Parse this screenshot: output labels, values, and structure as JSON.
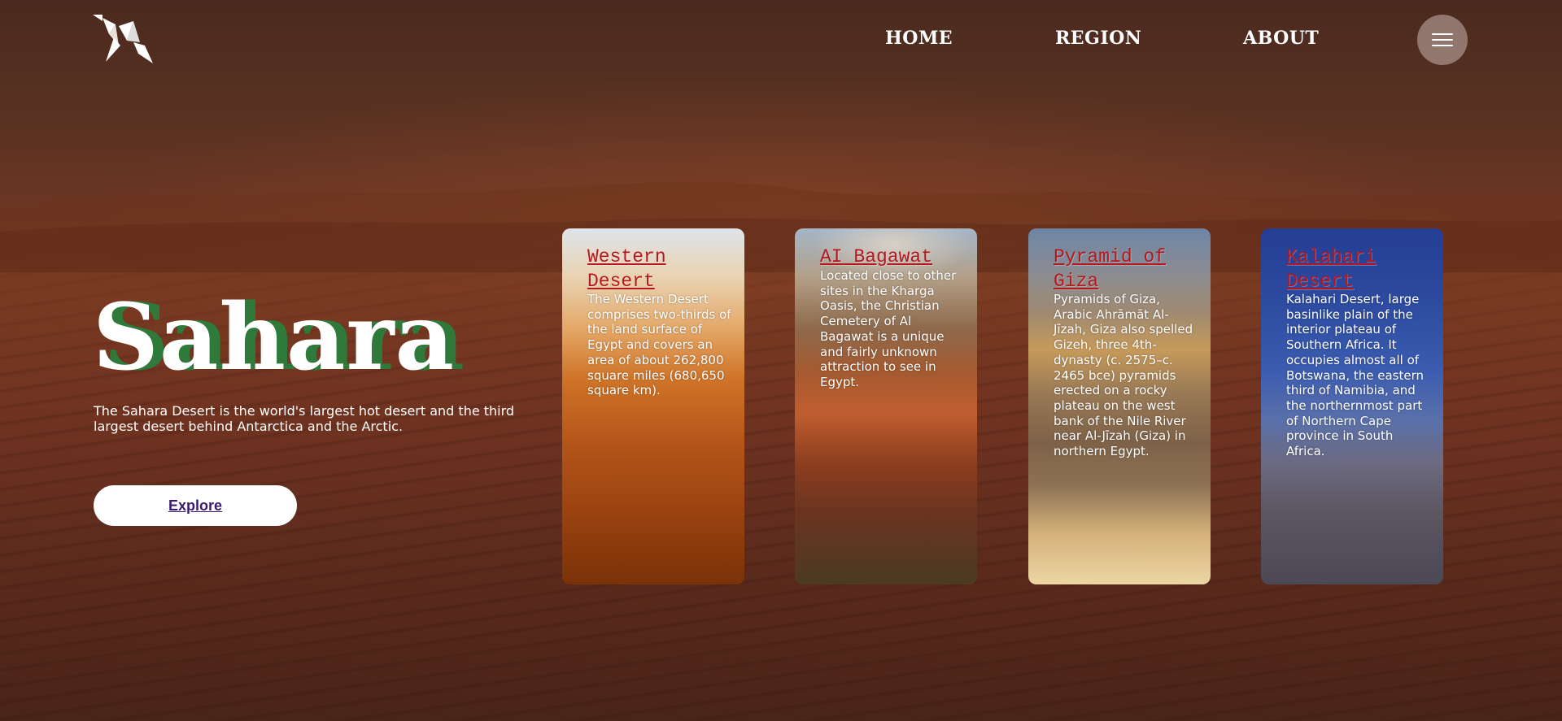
{
  "header": {
    "logo_icon": "origami-bird-logo",
    "nav": [
      {
        "label": "HOME"
      },
      {
        "label": "REGION"
      },
      {
        "label": "ABOUT"
      }
    ],
    "menu_icon": "hamburger-menu-icon"
  },
  "hero": {
    "title": "Sahara",
    "description": "The Sahara Desert is the world's largest hot desert and the third largest desert behind Antarctica and the Arctic.",
    "explore_label": "Explore",
    "title_shadow_color": "#2f7a3a"
  },
  "cards": [
    {
      "title": "Western Desert",
      "text": "The Western Desert comprises two-thirds of the land surface of Egypt and covers an area of about 262,800 square miles (680,650 square km)."
    },
    {
      "title": "AI Bagawat",
      "text": "Located close to other sites in the Kharga Oasis, the Christian Cemetery of Al Bagawat is a unique and fairly unknown attraction to see in Egypt."
    },
    {
      "title": "Pyramid of Giza",
      "text": "Pyramids of Giza, Arabic Ahrāmāt Al-Jīzah, Giza also spelled Gizeh, three 4th-dynasty (c. 2575–c. 2465 bce) pyramids erected on a rocky plateau on the west bank of the Nile River near Al-Jīzah (Giza) in northern Egypt."
    },
    {
      "title": "Kalahari Desert",
      "text": "Kalahari Desert, large basinlike plain of the interior plateau of Southern Africa. It occupies almost all of Botswana, the eastern third of Namibia, and the northernmost part of Northern Cape province in South Africa."
    }
  ],
  "colors": {
    "card_title": "#b4171e",
    "explore_text": "#3a1a6e"
  }
}
